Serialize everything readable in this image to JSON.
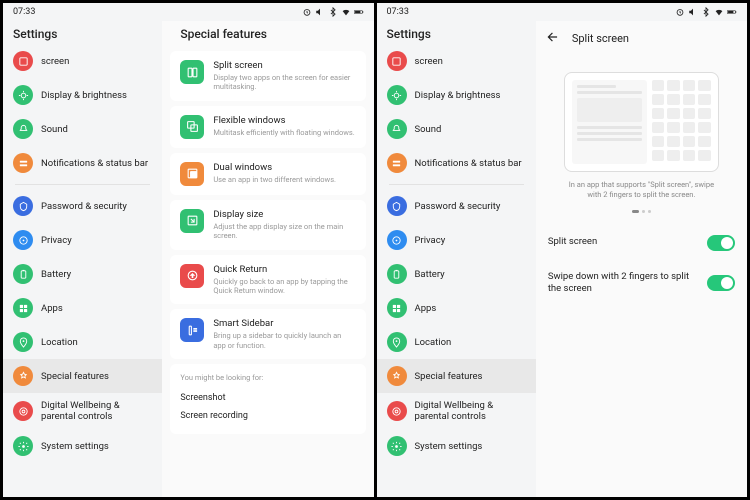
{
  "status": {
    "time": "07:33"
  },
  "nav": {
    "title": "Settings",
    "items": [
      {
        "label": "screen",
        "color": "#e94b4b"
      },
      {
        "label": "Display & brightness",
        "color": "#31c072"
      },
      {
        "label": "Sound",
        "color": "#31c072"
      },
      {
        "label": "Notifications & status bar",
        "color": "#f08a3c"
      },
      {
        "label": "Password & security",
        "color": "#3a6de0"
      },
      {
        "label": "Privacy",
        "color": "#2e8cf0"
      },
      {
        "label": "Battery",
        "color": "#31c072"
      },
      {
        "label": "Apps",
        "color": "#31c072"
      },
      {
        "label": "Location",
        "color": "#31c072"
      },
      {
        "label": "Special features",
        "color": "#f08a3c"
      },
      {
        "label": "Digital Wellbeing & parental controls",
        "color": "#e94b4b"
      },
      {
        "label": "System settings",
        "color": "#31c072"
      }
    ]
  },
  "features": {
    "title": "Special features",
    "items": [
      {
        "title": "Split screen",
        "desc": "Display two apps on the screen for easier multitasking.",
        "color": "#31c072"
      },
      {
        "title": "Flexible windows",
        "desc": "Multitask efficiently with floating windows.",
        "color": "#31c072"
      },
      {
        "title": "Dual windows",
        "desc": "Use an app in two different windows.",
        "color": "#f08a3c"
      },
      {
        "title": "Display size",
        "desc": "Adjust the app display size on the main screen.",
        "color": "#31c072"
      },
      {
        "title": "Quick Return",
        "desc": "Quickly go back to an app by tapping the Quick Return window.",
        "color": "#e94b4b"
      },
      {
        "title": "Smart Sidebar",
        "desc": "Bring up a sidebar to quickly launch an app or function.",
        "color": "#3a6de0"
      }
    ],
    "suggest_head": "You might be looking for:",
    "suggestions": [
      "Screenshot",
      "Screen recording"
    ]
  },
  "detail": {
    "title": "Split screen",
    "hint": "In an app that supports \"Split screen\", swipe with 2 fingers to split the screen.",
    "toggles": [
      {
        "label": "Split screen"
      },
      {
        "label": "Swipe down with 2 fingers to split the screen"
      }
    ]
  }
}
